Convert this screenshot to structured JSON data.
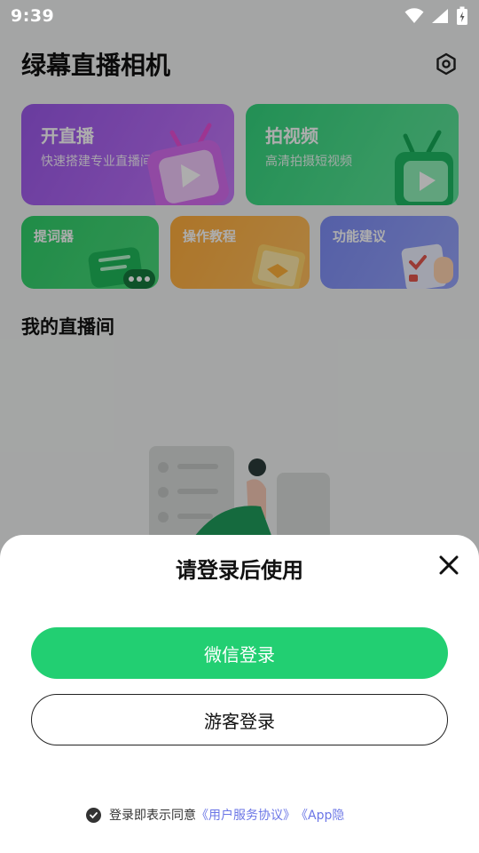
{
  "status_bar": {
    "time": "9:39"
  },
  "header": {
    "title": "绿幕直播相机"
  },
  "cards": {
    "live": {
      "title": "开直播",
      "subtitle": "快速搭建专业直播间"
    },
    "video": {
      "title": "拍视频",
      "subtitle": "高清拍摄短视频"
    },
    "prompter": {
      "title": "提词器"
    },
    "tutorial": {
      "title": "操作教程"
    },
    "suggest": {
      "title": "功能建议"
    }
  },
  "my_rooms": {
    "title": "我的直播间"
  },
  "login_sheet": {
    "title": "请登录后使用",
    "wechat_label": "微信登录",
    "guest_label": "游客登录",
    "agreement_prefix": "登录即表示同意",
    "agreement_link1": "《用户服务协议》",
    "agreement_link2": "《App隐"
  },
  "colors": {
    "accent_green": "#22cf72",
    "link": "#6b76e6"
  }
}
